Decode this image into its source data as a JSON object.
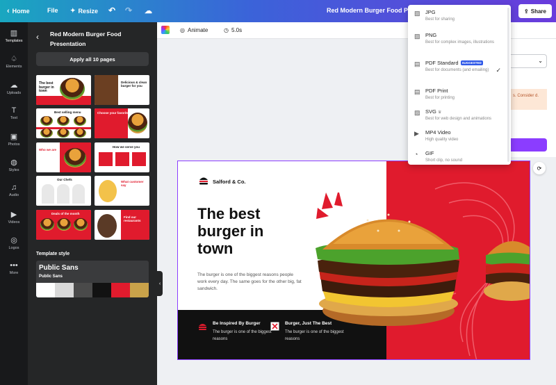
{
  "topbar": {
    "home": "Home",
    "file": "File",
    "resize": "Resize",
    "doc_title": "Red Modern Burger Food Presentat",
    "share": "Share"
  },
  "rail": [
    {
      "label": "Templates",
      "icon": "templates-icon"
    },
    {
      "label": "Elements",
      "icon": "elements-icon"
    },
    {
      "label": "Uploads",
      "icon": "uploads-icon"
    },
    {
      "label": "Text",
      "icon": "text-icon"
    },
    {
      "label": "Photos",
      "icon": "photos-icon"
    },
    {
      "label": "Styles",
      "icon": "styles-icon"
    },
    {
      "label": "Audio",
      "icon": "audio-icon"
    },
    {
      "label": "Videos",
      "icon": "videos-icon"
    },
    {
      "label": "Logos",
      "icon": "logos-icon"
    },
    {
      "label": "More",
      "icon": "more-icon"
    }
  ],
  "panel": {
    "title": "Red Modern Burger Food Presentation",
    "apply_button": "Apply all 10 pages",
    "template_style_label": "Template style",
    "font_heading": "Public Sans",
    "font_sub": "Public Sans",
    "swatches": [
      "#ffffff",
      "#d9d9d9",
      "#4a4a4a",
      "#121212",
      "#e01b2d",
      "#c9a24a"
    ]
  },
  "thumbs": {
    "t1_title": "The best burger in town",
    "t2_title": "Delicious & clean burger for you",
    "t3_title": "Best selling menu",
    "t4_title": "Choose your favorites",
    "t5_title": "Who we are",
    "t6_title": "How we serve you",
    "t7_title": "Our Chefs",
    "t8_title": "What customer say",
    "t9_title": "Deals of the month",
    "t10_title": "Find our restaurants"
  },
  "toolbar": {
    "animate": "Animate",
    "duration": "5.0s"
  },
  "canvas": {
    "brand": "Salford & Co.",
    "title": "The best burger in town",
    "body": "The burger is one of the biggest reasons people work every day. The same goes for the other big, fat sandwich.",
    "feature1_title": "Be Inspired By Burger",
    "feature1_body": "The burger is one of the biggest reasons",
    "feature2_title": "Burger, Just The Best",
    "feature2_body": "The burger is one of the biggest reasons"
  },
  "download_menu": {
    "items": [
      {
        "name": "JPG",
        "desc": "Best for sharing",
        "icon": "image-icon"
      },
      {
        "name": "PNG",
        "desc": "Best for complex images, illustrations",
        "icon": "image-icon"
      },
      {
        "name": "PDF Standard",
        "desc": "Best for documents (and emailing)",
        "badge": "SUGGESTED",
        "selected": true,
        "icon": "document-icon"
      },
      {
        "name": "PDF Print",
        "desc": "Best for printing",
        "icon": "document-icon"
      },
      {
        "name": "SVG",
        "desc": "Best for web design and animations",
        "icon": "image-icon"
      },
      {
        "name": "MP4 Video",
        "desc": "High quality video",
        "icon": "video-icon"
      },
      {
        "name": "GIF",
        "desc": "Short clip, no sound",
        "icon": "gif-icon"
      }
    ]
  },
  "behind_panel": {
    "warning_text": "s. Consider d."
  },
  "colors": {
    "brand_red": "#e01b2d",
    "accent_purple": "#8b3dff",
    "suggested_blue": "#2d57e8"
  }
}
